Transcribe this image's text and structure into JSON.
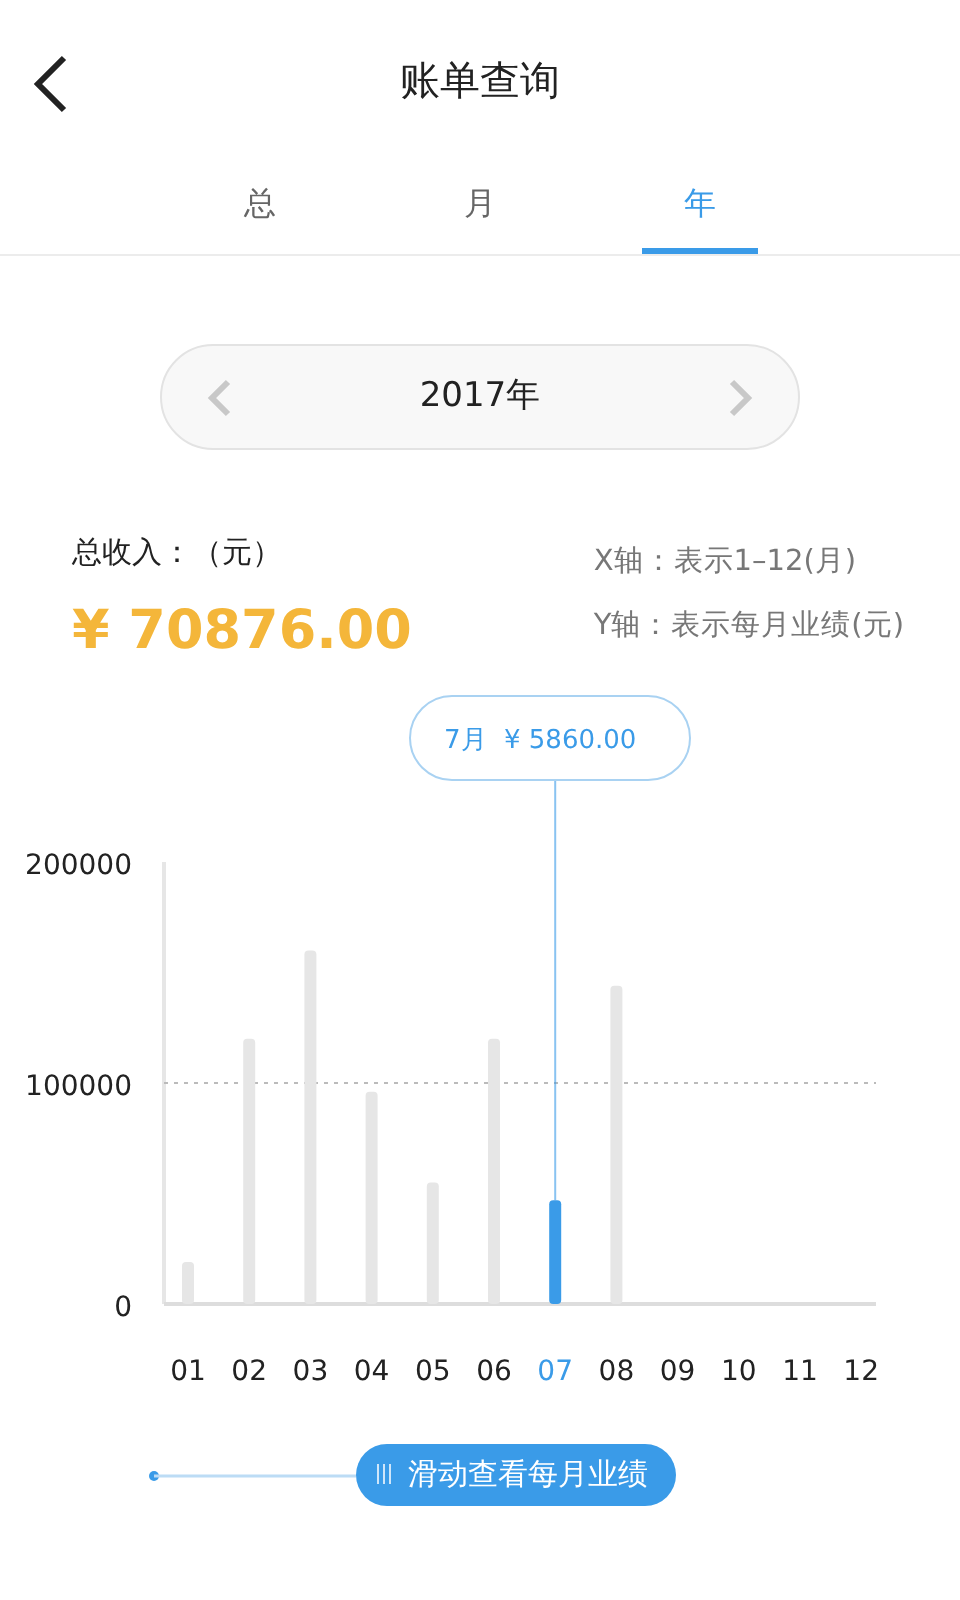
{
  "header": {
    "title": "账单查询"
  },
  "tabs": [
    {
      "label": "总",
      "selected": false
    },
    {
      "label": "月",
      "selected": false
    },
    {
      "label": "年",
      "selected": true
    }
  ],
  "year_picker": {
    "value": "2017年"
  },
  "summary": {
    "label": "总收入：（元）",
    "amount": "¥ 70876.00",
    "legend": [
      "X轴：表示1–12(月)",
      "Y轴：表示每月业绩(元)"
    ]
  },
  "chart": {
    "chart_data": {
      "type": "bar",
      "categories": [
        "01",
        "02",
        "03",
        "04",
        "05",
        "06",
        "07",
        "08",
        "09",
        "10",
        "11",
        "12"
      ],
      "series": [
        {
          "color": "#e6e6e6",
          "values": [
            19000,
            120000,
            160000,
            96000,
            55000,
            120000,
            null,
            144000,
            0,
            0,
            0,
            0
          ]
        },
        {
          "color": "#3a9be8",
          "values": [
            null,
            null,
            null,
            null,
            null,
            null,
            47000,
            null,
            null,
            null,
            null,
            null
          ]
        }
      ],
      "ylim": [
        0,
        200000
      ],
      "yticks": [
        0,
        100000,
        200000
      ],
      "ref_lines": [
        {
          "axis": "y",
          "value": 100000,
          "color": "#bbbbbb"
        },
        {
          "axis": "x",
          "value": "07",
          "color": "#3a9be8"
        }
      ]
    },
    "tooltip": {
      "month": "7月",
      "amount": "¥ 5860.00",
      "color": "#3a9be8"
    }
  },
  "slider": {
    "hint": "滑动查看每月业绩"
  }
}
